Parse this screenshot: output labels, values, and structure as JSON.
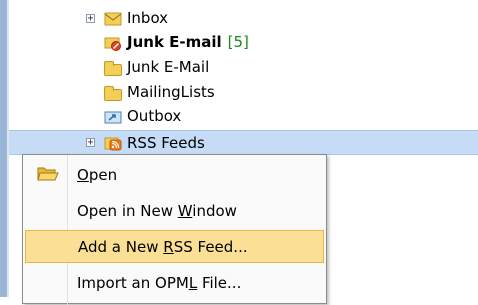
{
  "folder_tree": {
    "items": [
      {
        "label": "Inbox",
        "count": "",
        "icon": "inbox-folder-icon",
        "expander": "+"
      },
      {
        "label": "Junk E-mail",
        "count": "[5]",
        "icon": "junk-email-folder-icon",
        "expander": ""
      },
      {
        "label": "Junk E-Mail",
        "count": "",
        "icon": "folder-icon",
        "expander": ""
      },
      {
        "label": "MailingLists",
        "count": "",
        "icon": "folder-icon",
        "expander": ""
      },
      {
        "label": "Outbox",
        "count": "",
        "icon": "outbox-folder-icon",
        "expander": ""
      },
      {
        "label": "RSS Feeds",
        "count": "",
        "icon": "rss-folder-icon",
        "expander": "+"
      }
    ]
  },
  "context_menu": {
    "items": [
      {
        "pre": "",
        "accel": "O",
        "post": "pen",
        "icon": "open-folder-icon"
      },
      {
        "pre": "Open in New ",
        "accel": "W",
        "post": "indow",
        "icon": ""
      },
      {
        "pre": "Add a New ",
        "accel": "R",
        "post": "SS Feed...",
        "icon": ""
      },
      {
        "pre": "Import an OPM",
        "accel": "L",
        "post": " File...",
        "icon": ""
      }
    ]
  },
  "colors": {
    "selection": "#c5dbf6",
    "menu_highlight": "#fbdf95",
    "count_green": "#1b8a1b"
  }
}
